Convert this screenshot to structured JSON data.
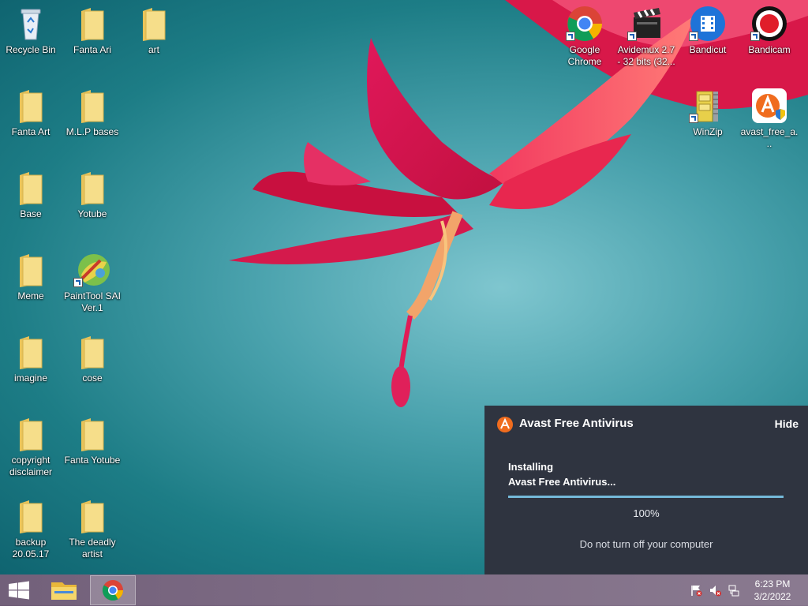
{
  "desktop": {
    "left_icons": [
      {
        "label": "Recycle Bin",
        "icon": "recycle-bin-icon"
      },
      {
        "label": "Fanta Ari",
        "icon": "folder-icon"
      },
      {
        "label": "art",
        "icon": "folder-icon"
      },
      {
        "label": "Fanta Art",
        "icon": "folder-icon"
      },
      {
        "label": "M.L.P bases",
        "icon": "folder-icon"
      },
      {
        "label": "Base",
        "icon": "folder-icon"
      },
      {
        "label": "Yotube",
        "icon": "folder-icon"
      },
      {
        "label": "Meme",
        "icon": "folder-icon"
      },
      {
        "label": "PaintTool SAI Ver.1",
        "icon": "painttool-sai-icon"
      },
      {
        "label": "imagine",
        "icon": "folder-icon"
      },
      {
        "label": "cose",
        "icon": "folder-icon"
      },
      {
        "label": "copyright disclaimer",
        "icon": "folder-icon"
      },
      {
        "label": "Fanta Yotube",
        "icon": "folder-icon"
      },
      {
        "label": "backup 20.05.17",
        "icon": "folder-icon"
      },
      {
        "label": "The deadly artist",
        "icon": "folder-icon"
      }
    ],
    "right_icons": [
      {
        "label": "Google Chrome",
        "icon": "chrome-icon"
      },
      {
        "label": "Avidemux 2.7 - 32 bits (32...",
        "icon": "avidemux-icon"
      },
      {
        "label": "Bandicut",
        "icon": "bandicut-icon"
      },
      {
        "label": "Bandicam",
        "icon": "bandicam-icon"
      },
      {
        "label": "WinZip",
        "icon": "winzip-icon"
      },
      {
        "label": "avast_free_a...",
        "icon": "avast-installer-icon"
      }
    ]
  },
  "avast": {
    "title": "Avast Free Antivirus",
    "hide_label": "Hide",
    "status_line1": "Installing",
    "status_line2": "Avast Free Antivirus...",
    "progress": 1.0,
    "percent_label": "100%",
    "warning": "Do not turn off your computer"
  },
  "taskbar": {
    "time": "6:23 PM",
    "date": "3/2/2022"
  },
  "colors": {
    "avast_orange": "#f06c1e",
    "notification_bg": "#2f3440",
    "progress_fill": "#74b9d9"
  }
}
